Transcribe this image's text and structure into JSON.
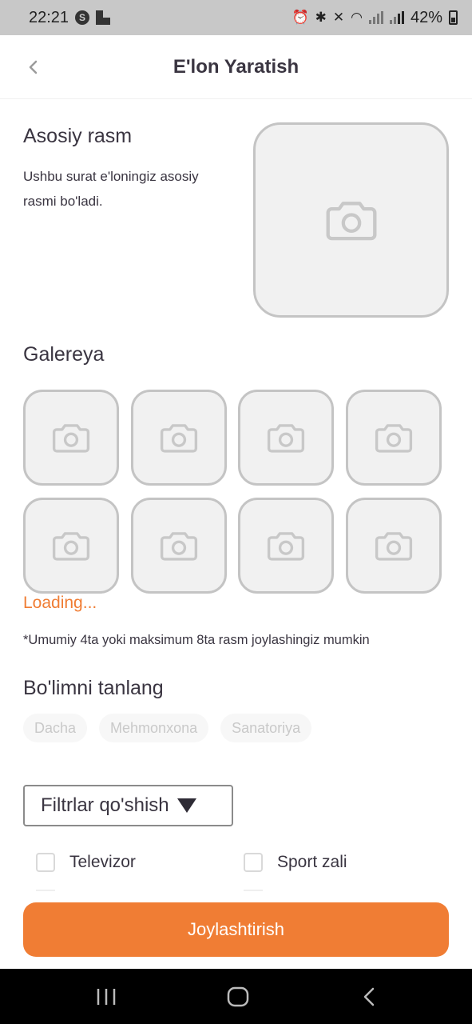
{
  "status_bar": {
    "time": "22:21",
    "badge": "S",
    "battery_percent": "42%"
  },
  "header": {
    "title": "E'lon Yaratish"
  },
  "main_photo": {
    "title": "Asosiy rasm",
    "description": "Ushbu surat e'loningiz asosiy rasmi bo'ladi."
  },
  "gallery": {
    "title": "Galereya",
    "slot_count": 8,
    "loading": "Loading...",
    "note": "*Umumiy 4ta yoki maksimum 8ta rasm joylashingiz mumkin"
  },
  "category": {
    "title": "Bo'limni tanlang",
    "options": [
      "Dacha",
      "Mehmonxona",
      "Sanatoriya"
    ]
  },
  "filters": {
    "button_label": "Filtrlar qo'shish",
    "items": [
      "Televizor",
      "Sport zali"
    ]
  },
  "submit": {
    "label": "Joylashtirish"
  },
  "icons": {
    "back": "chevron-left-icon",
    "camera": "camera-icon"
  },
  "colors": {
    "accent": "#f07d34",
    "text": "#3a3541",
    "placeholder_border": "#c4c4c4",
    "placeholder_bg": "#f1f1f1"
  }
}
